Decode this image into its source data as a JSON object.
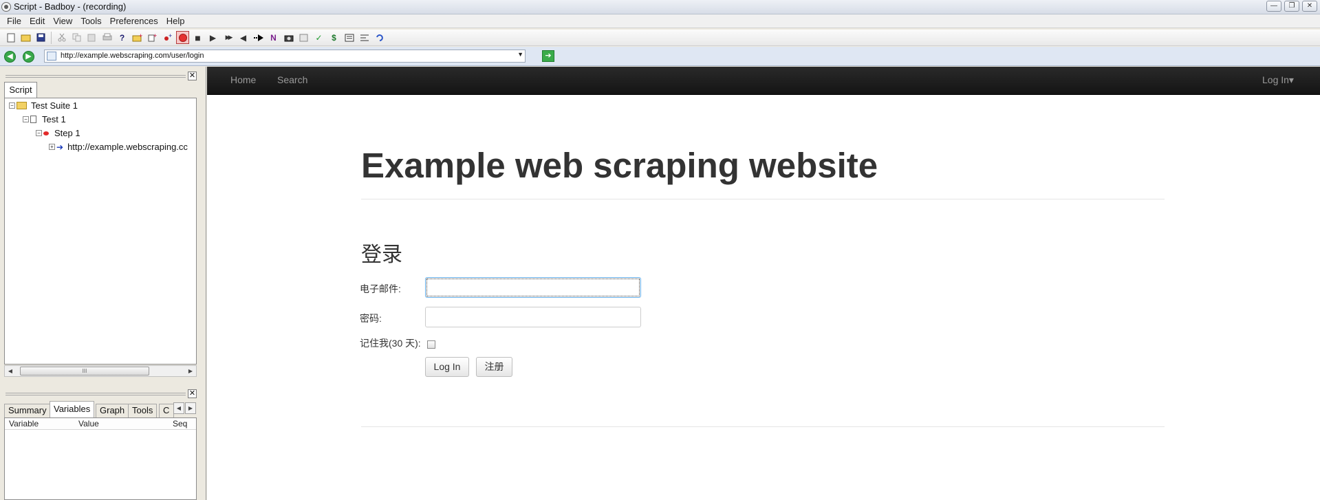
{
  "window": {
    "title": "Script - Badboy - (recording)",
    "min_glyph": "—",
    "restore_glyph": "❐",
    "close_glyph": "✕"
  },
  "menu": [
    "File",
    "Edit",
    "View",
    "Tools",
    "Preferences",
    "Help"
  ],
  "toolbar": {
    "icons": [
      "new-file-icon",
      "open-folder-icon",
      "save-icon",
      "cut-icon",
      "copy-icon",
      "paste-icon",
      "print-icon",
      "help-icon",
      "add-suite-icon",
      "add-test-icon",
      "add-step-icon",
      "record-icon",
      "stop-icon",
      "play-icon",
      "play-all-icon",
      "rewind-icon",
      "step-over-icon",
      "navigation-icon",
      "screenshot-icon",
      "summary-icon",
      "check-icon",
      "variable-icon",
      "report-icon",
      "align-icon",
      "refresh-icon"
    ],
    "glyphs": {
      "back": "◀",
      "forward": "▶",
      "go": "➔",
      "dropdown": "▼",
      "play": "▶",
      "play_all": "▶▶",
      "rewind": "◀",
      "stop": "■",
      "check": "✓",
      "dollar": "$"
    }
  },
  "address_bar": {
    "url": "http://example.webscraping.com/user/login"
  },
  "left_pane": {
    "close_glyph": "✕",
    "script_tab": "Script",
    "tree": [
      {
        "label": "Test Suite 1",
        "type": "suite"
      },
      {
        "label": "Test 1",
        "type": "test"
      },
      {
        "label": "Step 1",
        "type": "step"
      },
      {
        "label": "http://example.webscraping.cc",
        "type": "request"
      }
    ],
    "expander_glyph": "−",
    "collapsed_glyph": "+",
    "scroll": {
      "left": "◀",
      "right": "▶",
      "grip": "III"
    },
    "bottom_tabs": [
      "Summary",
      "Variables",
      "Graph",
      "Tools",
      "C"
    ],
    "active_bottom_tab": "Variables",
    "tab_scroll": {
      "left": "◀",
      "right": "▶"
    },
    "variable_columns": [
      "Variable",
      "Value",
      "Seq"
    ]
  },
  "page": {
    "nav": {
      "home": "Home",
      "search": "Search",
      "login": "Log In▾"
    },
    "heading": "Example web scraping website",
    "form_title": "登录",
    "email_label": "电子邮件:",
    "password_label": "密码:",
    "remember_label": "记住我(30 天):",
    "login_button": "Log In",
    "register_button": "注册"
  }
}
